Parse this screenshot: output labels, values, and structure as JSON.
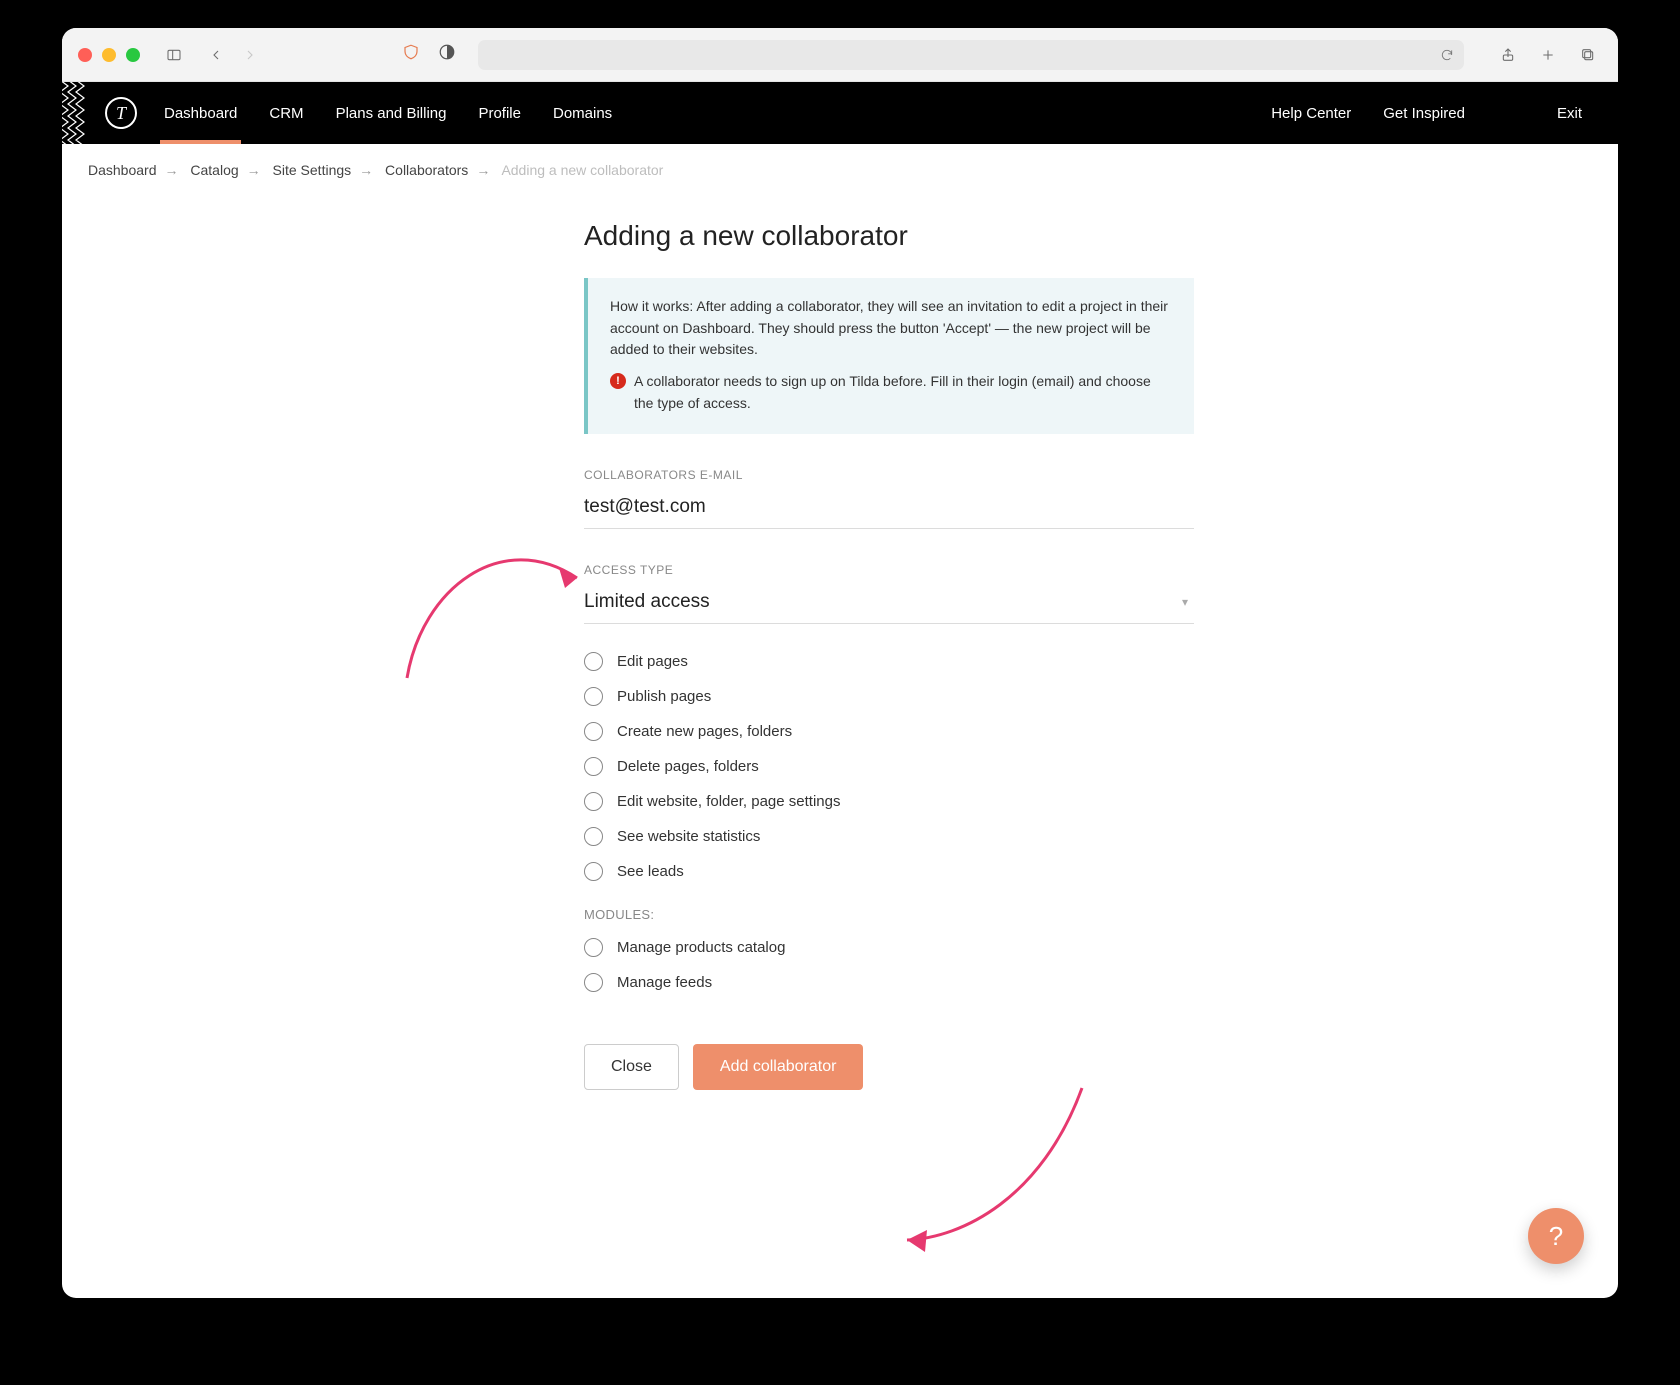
{
  "nav": {
    "items": [
      "Dashboard",
      "CRM",
      "Plans and Billing",
      "Profile",
      "Domains"
    ],
    "right": {
      "help": "Help Center",
      "inspired": "Get Inspired",
      "exit": "Exit"
    }
  },
  "breadcrumb": {
    "items": [
      "Dashboard",
      "Catalog",
      "Site Settings",
      "Collaborators"
    ],
    "current": "Adding a new collaborator"
  },
  "page": {
    "title": "Adding a new collaborator",
    "info_title": "How it works:",
    "info_text": " After adding a collaborator, they will see an invitation to edit a project in their account on Dashboard. They should press the button 'Accept' — the new project will be added to their websites.",
    "info_warn": "A collaborator needs to sign up on Tilda before. Fill in their login (email) and choose the type of access.",
    "email_label": "COLLABORATORS E-MAIL",
    "email_value": "test@test.com",
    "access_label": "ACCESS TYPE",
    "access_value": "Limited access",
    "permissions": [
      "Edit pages",
      "Publish pages",
      "Create new pages, folders",
      "Delete pages, folders",
      "Edit website, folder, page settings",
      "See website statistics",
      "See leads"
    ],
    "modules_label": "MODULES:",
    "modules": [
      "Manage products catalog",
      "Manage feeds"
    ],
    "close": "Close",
    "add": "Add collaborator"
  }
}
